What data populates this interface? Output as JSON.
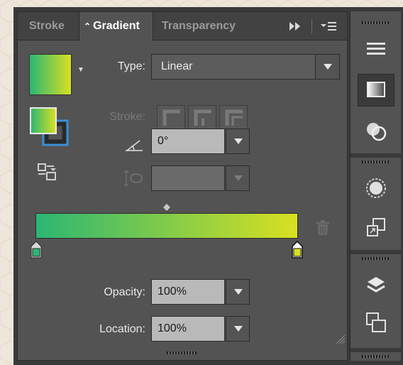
{
  "tabs": [
    {
      "label": "Stroke"
    },
    {
      "label": "Gradient",
      "caret": "⌃"
    },
    {
      "label": "Transparency"
    }
  ],
  "type": {
    "label": "Type:",
    "value": "Linear"
  },
  "stroke": {
    "label": "Stroke:"
  },
  "angle": {
    "value": "0°"
  },
  "aspect": {
    "value": ""
  },
  "opacity": {
    "label": "Opacity:",
    "value": "100%"
  },
  "location": {
    "label": "Location:",
    "value": "100%"
  },
  "colors": {
    "gradient_start": "#2bb673",
    "gradient_end": "#d9e021",
    "panel_bg": "#535353",
    "field_bg": "#b9b9b9"
  },
  "icons": {
    "expand": "double-chevron-right-icon",
    "menu": "panel-menu-icon",
    "trash": "trash-icon",
    "angle": "angle-icon",
    "aspect": "aspect-ratio-icon",
    "reverse": "reverse-gradient-icon"
  },
  "dock": {
    "items": [
      "hamburger-icon",
      "gradient-icon",
      "transparency-icon",
      "appearance-icon",
      "artboard-icon",
      "layers-icon",
      "links-icon"
    ]
  }
}
